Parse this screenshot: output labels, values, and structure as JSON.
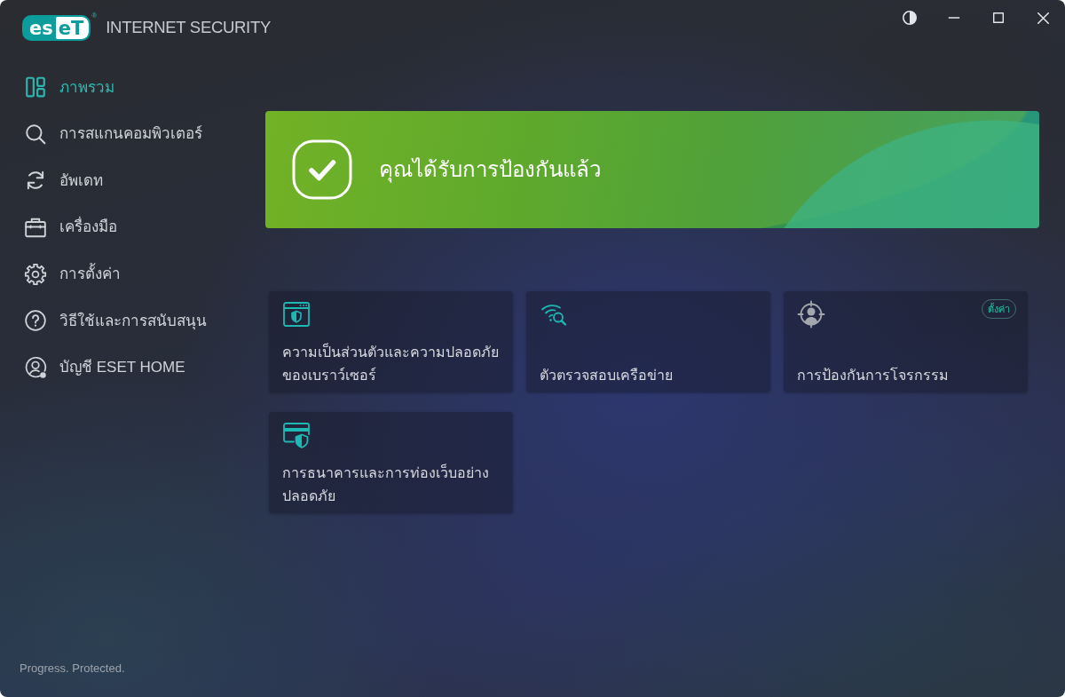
{
  "window": {
    "logo": [
      "es",
      "eT"
    ],
    "logo_mark": "®",
    "product": "INTERNET SECURITY"
  },
  "sidebar": {
    "items": [
      {
        "kind": "overview",
        "label": "ภาพรวม",
        "selected": true
      },
      {
        "kind": "scan",
        "label": "การสแกนคอมพิวเตอร์",
        "selected": false
      },
      {
        "kind": "update",
        "label": "อัพเดท",
        "selected": false
      },
      {
        "kind": "tools",
        "label": "เครื่องมือ",
        "selected": false
      },
      {
        "kind": "settings",
        "label": "การตั้งค่า",
        "selected": false
      },
      {
        "kind": "help",
        "label": "วิธีใช้และการสนับสนุน",
        "selected": false
      },
      {
        "kind": "account",
        "label": "บัญชี ESET HOME",
        "selected": false
      }
    ],
    "footer": "Progress. Protected."
  },
  "status_banner": {
    "message": "คุณได้รับการป้องกันแล้ว"
  },
  "tiles": [
    {
      "kind": "browser",
      "label": "ความเป็นส่วนตัวและความปลอดภัยของเบราว์เซอร์",
      "active": true
    },
    {
      "kind": "network",
      "label": "ตัวตรวจสอบเครือข่าย",
      "active": true
    },
    {
      "kind": "antitheft",
      "label": "การป้องกันการโจรกรรม",
      "active": false,
      "badge": "ตั้งค่า"
    },
    {
      "kind": "banking",
      "label": "การธนาคารและการท่องเว็บอย่างปลอดภัย",
      "active": true
    }
  ]
}
